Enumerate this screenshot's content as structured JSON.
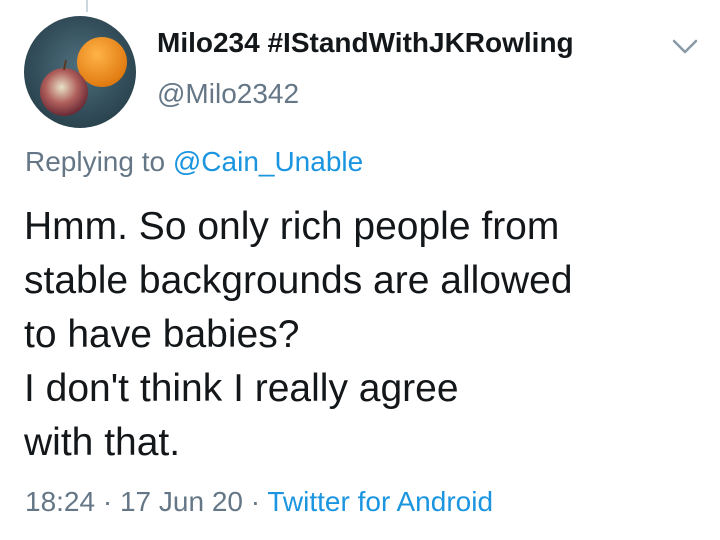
{
  "tweet": {
    "display_name": "Milo234 #IStandWithJKRowling",
    "handle": "@Milo2342",
    "avatar_icon": "avatar-orange-and-apple",
    "menu_icon": "chevron-down-icon",
    "reply": {
      "prefix": "Replying to",
      "mention": "@Cain_Unable"
    },
    "body_lines": [
      "Hmm. So only rich people from",
      "stable backgrounds are allowed",
      "to have babies?",
      "I don't think I really agree",
      "with that."
    ],
    "time": "18:24",
    "separator": "·",
    "date": "17 Jun 20",
    "source": "Twitter for Android"
  },
  "colors": {
    "text": "#14171a",
    "secondary": "#657786",
    "link": "#1b95e0",
    "thread_line": "#ccd6dd"
  }
}
